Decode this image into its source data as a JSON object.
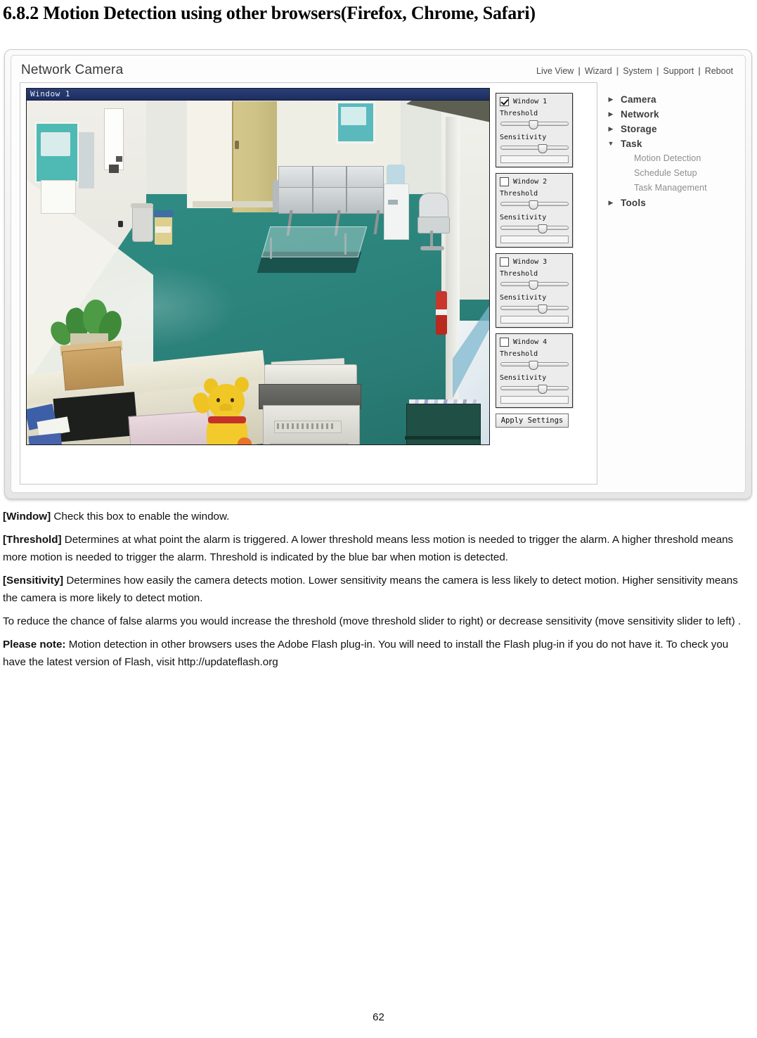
{
  "heading": "6.8.2 Motion Detection using other browsers(Firefox, Chrome, Safari)",
  "device": {
    "brand": "Network Camera",
    "nav": [
      "Live View",
      "Wizard",
      "System",
      "Support",
      "Reboot"
    ],
    "nav_separator": "|",
    "video": {
      "overlay_label": "Window 1"
    },
    "controls": {
      "threshold_label": "Threshold",
      "sensitivity_label": "Sensitivity",
      "apply_label": "Apply Settings",
      "windows": [
        {
          "label": "Window 1",
          "enabled": true,
          "threshold_pct": 48,
          "sensitivity_pct": 62,
          "level_pct": 0
        },
        {
          "label": "Window 2",
          "enabled": false,
          "threshold_pct": 48,
          "sensitivity_pct": 62,
          "level_pct": 0
        },
        {
          "label": "Window 3",
          "enabled": false,
          "threshold_pct": 48,
          "sensitivity_pct": 62,
          "level_pct": 0
        },
        {
          "label": "Window 4",
          "enabled": false,
          "threshold_pct": 48,
          "sensitivity_pct": 62,
          "level_pct": 0
        }
      ]
    },
    "menu": [
      {
        "label": "Camera",
        "expanded": false,
        "arrow": "▶"
      },
      {
        "label": "Network",
        "expanded": false,
        "arrow": "▶"
      },
      {
        "label": "Storage",
        "expanded": false,
        "arrow": "▶"
      },
      {
        "label": "Task",
        "expanded": true,
        "arrow": "▼"
      },
      {
        "label": "Tools",
        "expanded": false,
        "arrow": "▶"
      }
    ],
    "menu_sub_items": [
      "Motion Detection",
      "Schedule Setup",
      "Task Management"
    ]
  },
  "body": {
    "window_term": "[Window]",
    "window_text": " Check this box to enable the window.",
    "threshold_term": "[Threshold]",
    "threshold_text": " Determines at what point the alarm is triggered. A lower threshold means less motion is needed to trigger the alarm. A higher threshold means more motion is needed to trigger the alarm. Threshold is indicated by the blue bar when motion is detected.",
    "sensitivity_term": "[Sensitivity]",
    "sensitivity_text": " Determines how easily the camera detects motion. Lower sensitivity means the camera is less likely to detect motion. Higher sensitivity means the camera is more likely to detect motion.",
    "advice_text": "To reduce the chance of false alarms you would increase the threshold (move threshold slider to right) or decrease sensitivity (move sensitivity slider to left) .",
    "note_term": "Please note:",
    "note_text": " Motion detection in other browsers uses the Adobe Flash plug-in. You will need to install the Flash plug-in if you do not have it. To check you have the latest version of Flash, visit http://updateflash.org"
  },
  "page_number": "62",
  "colors": {
    "title_bar": "#23356a",
    "floor": "#2c867e",
    "level_fill": "#3f63c4",
    "menu_label": "#3b3b3b",
    "menu_sub": "#8e8e8e"
  }
}
